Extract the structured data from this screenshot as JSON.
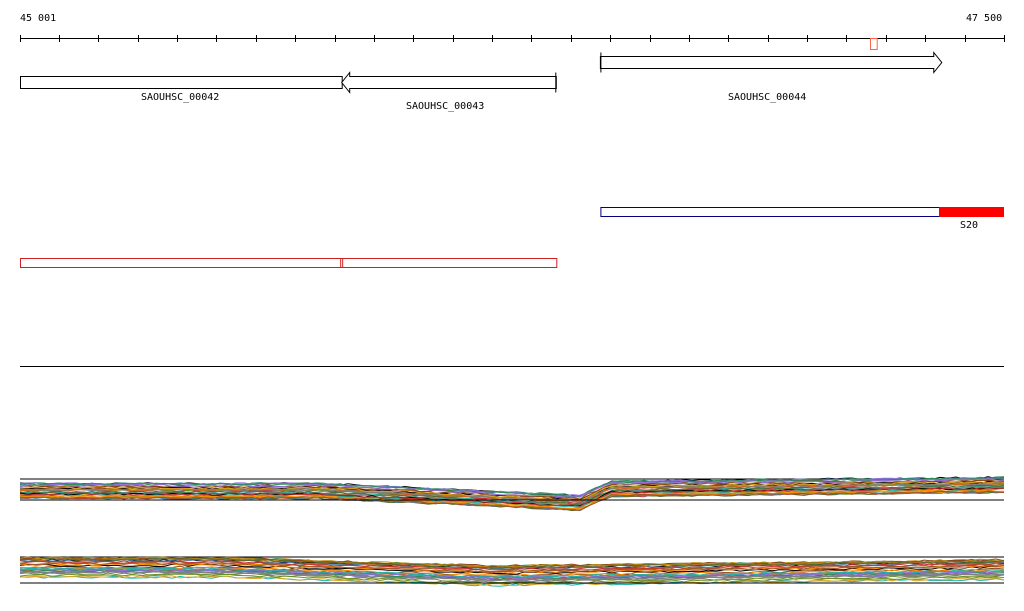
{
  "ruler": {
    "start_label": "45 001",
    "end_label": "47 500",
    "start": 45001,
    "end": 47500,
    "minor_tick_step": 100
  },
  "genes": [
    {
      "id": "SAOUHSC_00042",
      "label": "SAOUHSC_00042",
      "start": 45001,
      "end": 45818,
      "strand": "+"
    },
    {
      "id": "SAOUHSC_00043",
      "label": "SAOUHSC_00043",
      "start": 45818,
      "end": 46363,
      "strand": "-"
    },
    {
      "id": "SAOUHSC_00044",
      "label": "SAOUHSC_00044",
      "start": 46475,
      "end": 47342,
      "strand": "+"
    }
  ],
  "small_feature": {
    "start": 47161,
    "end": 47178,
    "color": "#ff6347"
  },
  "features": [
    {
      "label": "S20",
      "label_visible": true,
      "start": 46475,
      "end": 47500,
      "filled_from": 47335,
      "outline": "#000080",
      "fill": "#ff0000"
    },
    {
      "label": "",
      "label_visible": false,
      "start": 45001,
      "end": 46363,
      "divider_at": 45818,
      "outline": "#d22020",
      "fill": "#ffffff"
    }
  ],
  "coverage_panels": [
    {
      "name": "coverage-track-1",
      "breakpoint": 46475
    },
    {
      "name": "coverage-track-2",
      "breakpoint": 46200
    }
  ],
  "colors": {
    "gene_outline": "#000000",
    "separator": "#000000",
    "trace_palette": [
      "#000000",
      "#c83232",
      "#2e8b57",
      "#6b8e23",
      "#d2691e",
      "#8b4513",
      "#4682b4",
      "#9370db",
      "#808080",
      "#b8860b",
      "#20b2aa",
      "#ff8c00",
      "#556b2f",
      "#a0522d",
      "#708090",
      "#daa520"
    ]
  }
}
